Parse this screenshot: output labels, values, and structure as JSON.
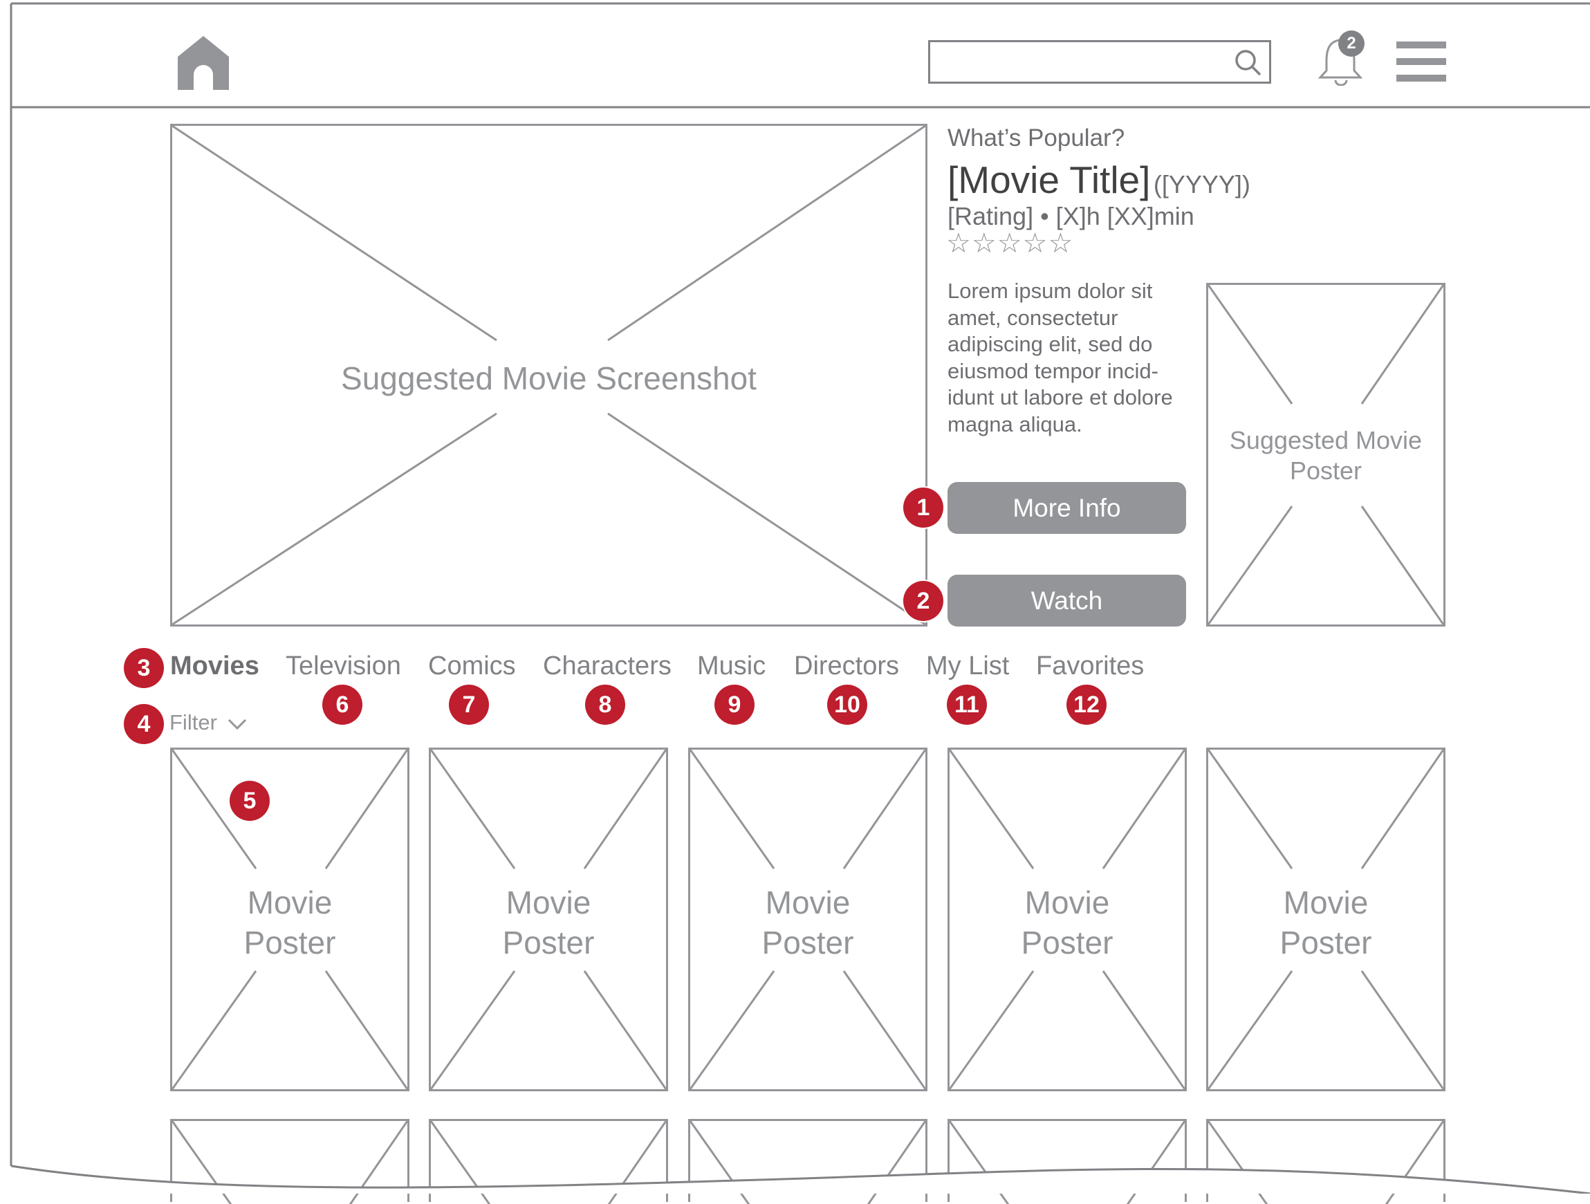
{
  "header": {
    "home_icon": "home-icon",
    "search_placeholder": "",
    "search_icon": "search-icon",
    "notification_icon": "bell-icon",
    "notification_count": "2",
    "menu_icon": "hamburger-menu-icon"
  },
  "hero": {
    "screenshot_label": "Suggested Movie Screenshot",
    "section_label": "What’s Popular?",
    "movie_title": "[Movie Title]",
    "movie_year": "([YYYY])",
    "meta": "[Rating] • [X]h [XX]min",
    "stars": "☆☆☆☆☆",
    "description": "Lorem ipsum dolor sit amet, consectetur adipiscing elit, sed do eiusmod tempor incid-idunt ut labore et dolore magna aliqua.",
    "poster_label": "Suggested Movie Poster",
    "more_info_label": "More Info",
    "watch_label": "Watch"
  },
  "tabs": [
    {
      "label": "Movies",
      "active": true
    },
    {
      "label": "Television",
      "active": false
    },
    {
      "label": "Comics",
      "active": false
    },
    {
      "label": "Characters",
      "active": false
    },
    {
      "label": "Music",
      "active": false
    },
    {
      "label": "Directors",
      "active": false
    },
    {
      "label": "My List",
      "active": false
    },
    {
      "label": "Favorites",
      "active": false
    }
  ],
  "filter": {
    "label": "Filter",
    "icon": "chevron-down-icon"
  },
  "posters": {
    "row1": [
      "Movie\nPoster",
      "Movie\nPoster",
      "Movie\nPoster",
      "Movie\nPoster",
      "Movie\nPoster"
    ],
    "row2_count": 5
  },
  "annotations": [
    "1",
    "2",
    "3",
    "4",
    "5",
    "6",
    "7",
    "8",
    "9",
    "10",
    "11",
    "12"
  ],
  "colors": {
    "annotation": "#be1e2d",
    "button": "#939598",
    "wire": "#939598",
    "text": "#6d6e71"
  }
}
